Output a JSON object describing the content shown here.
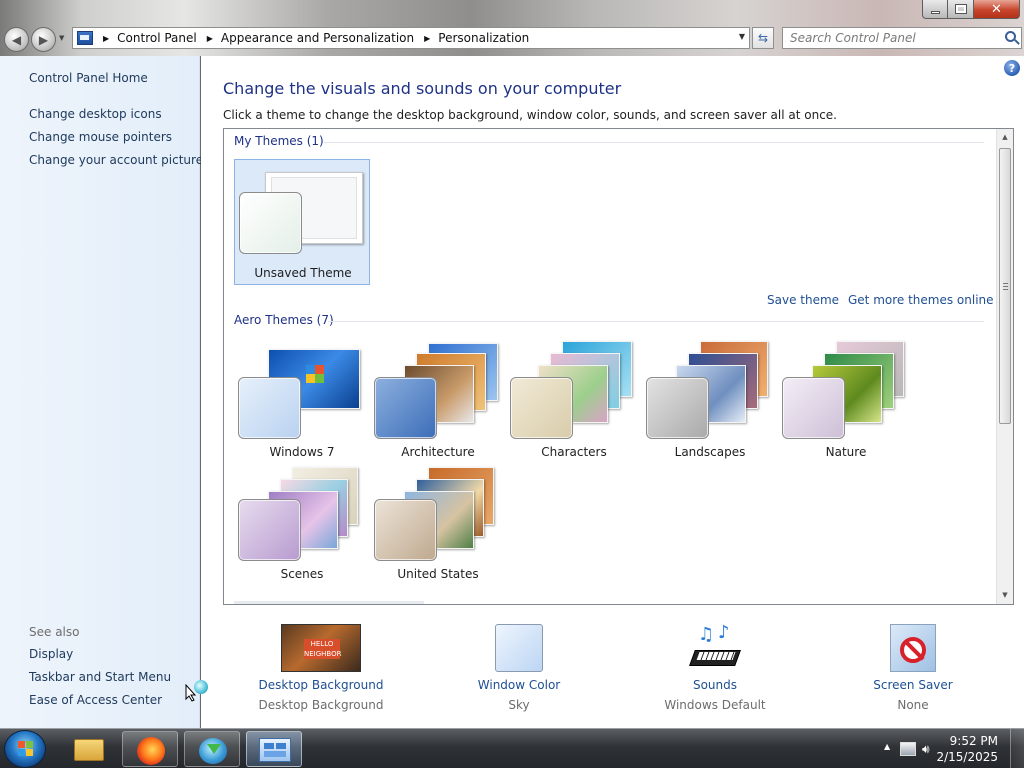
{
  "window": {
    "breadcrumb": [
      "Control Panel",
      "Appearance and Personalization",
      "Personalization"
    ],
    "search_placeholder": "Search Control Panel",
    "help_label": "?"
  },
  "sidebar": {
    "home": "Control Panel Home",
    "tasks": [
      "Change desktop icons",
      "Change mouse pointers",
      "Change your account picture"
    ],
    "see_also_label": "See also",
    "see_also": [
      "Display",
      "Taskbar and Start Menu",
      "Ease of Access Center"
    ]
  },
  "main": {
    "heading": "Change the visuals and sounds on your computer",
    "description": "Click a theme to change the desktop background, window color, sounds, and screen saver all at once.",
    "my_themes": {
      "header": "My Themes (1)",
      "items": [
        {
          "label": "Unsaved Theme",
          "selected": true
        }
      ],
      "save_link": "Save theme",
      "more_link": "Get more themes online"
    },
    "aero_themes": {
      "header": "Aero Themes (7)",
      "items": [
        {
          "label": "Windows 7",
          "color": "#2b6fd2"
        },
        {
          "label": "Architecture",
          "color": "#3a78c9"
        },
        {
          "label": "Characters",
          "color": "#7fc3d7"
        },
        {
          "label": "Landscapes",
          "color": "#8aa0c2"
        },
        {
          "label": "Nature",
          "color": "#7da842"
        },
        {
          "label": "Scenes",
          "color": "#9f7ac3"
        },
        {
          "label": "United States",
          "color": "#c79250"
        }
      ]
    }
  },
  "bottom_tiles": [
    {
      "title": "Desktop Background",
      "subtitle": "Desktop Background",
      "icon": "desktop-background-icon"
    },
    {
      "title": "Window Color",
      "subtitle": "Sky",
      "icon": "window-color-icon"
    },
    {
      "title": "Sounds",
      "subtitle": "Windows Default",
      "icon": "sounds-icon"
    },
    {
      "title": "Screen Saver",
      "subtitle": "None",
      "icon": "screen-saver-icon"
    }
  ],
  "taskbar": {
    "time": "9:52 PM",
    "date": "2/15/2025",
    "items": [
      "windows-explorer-icon",
      "firefox-icon",
      "download-manager-icon",
      "control-panel-icon"
    ]
  }
}
